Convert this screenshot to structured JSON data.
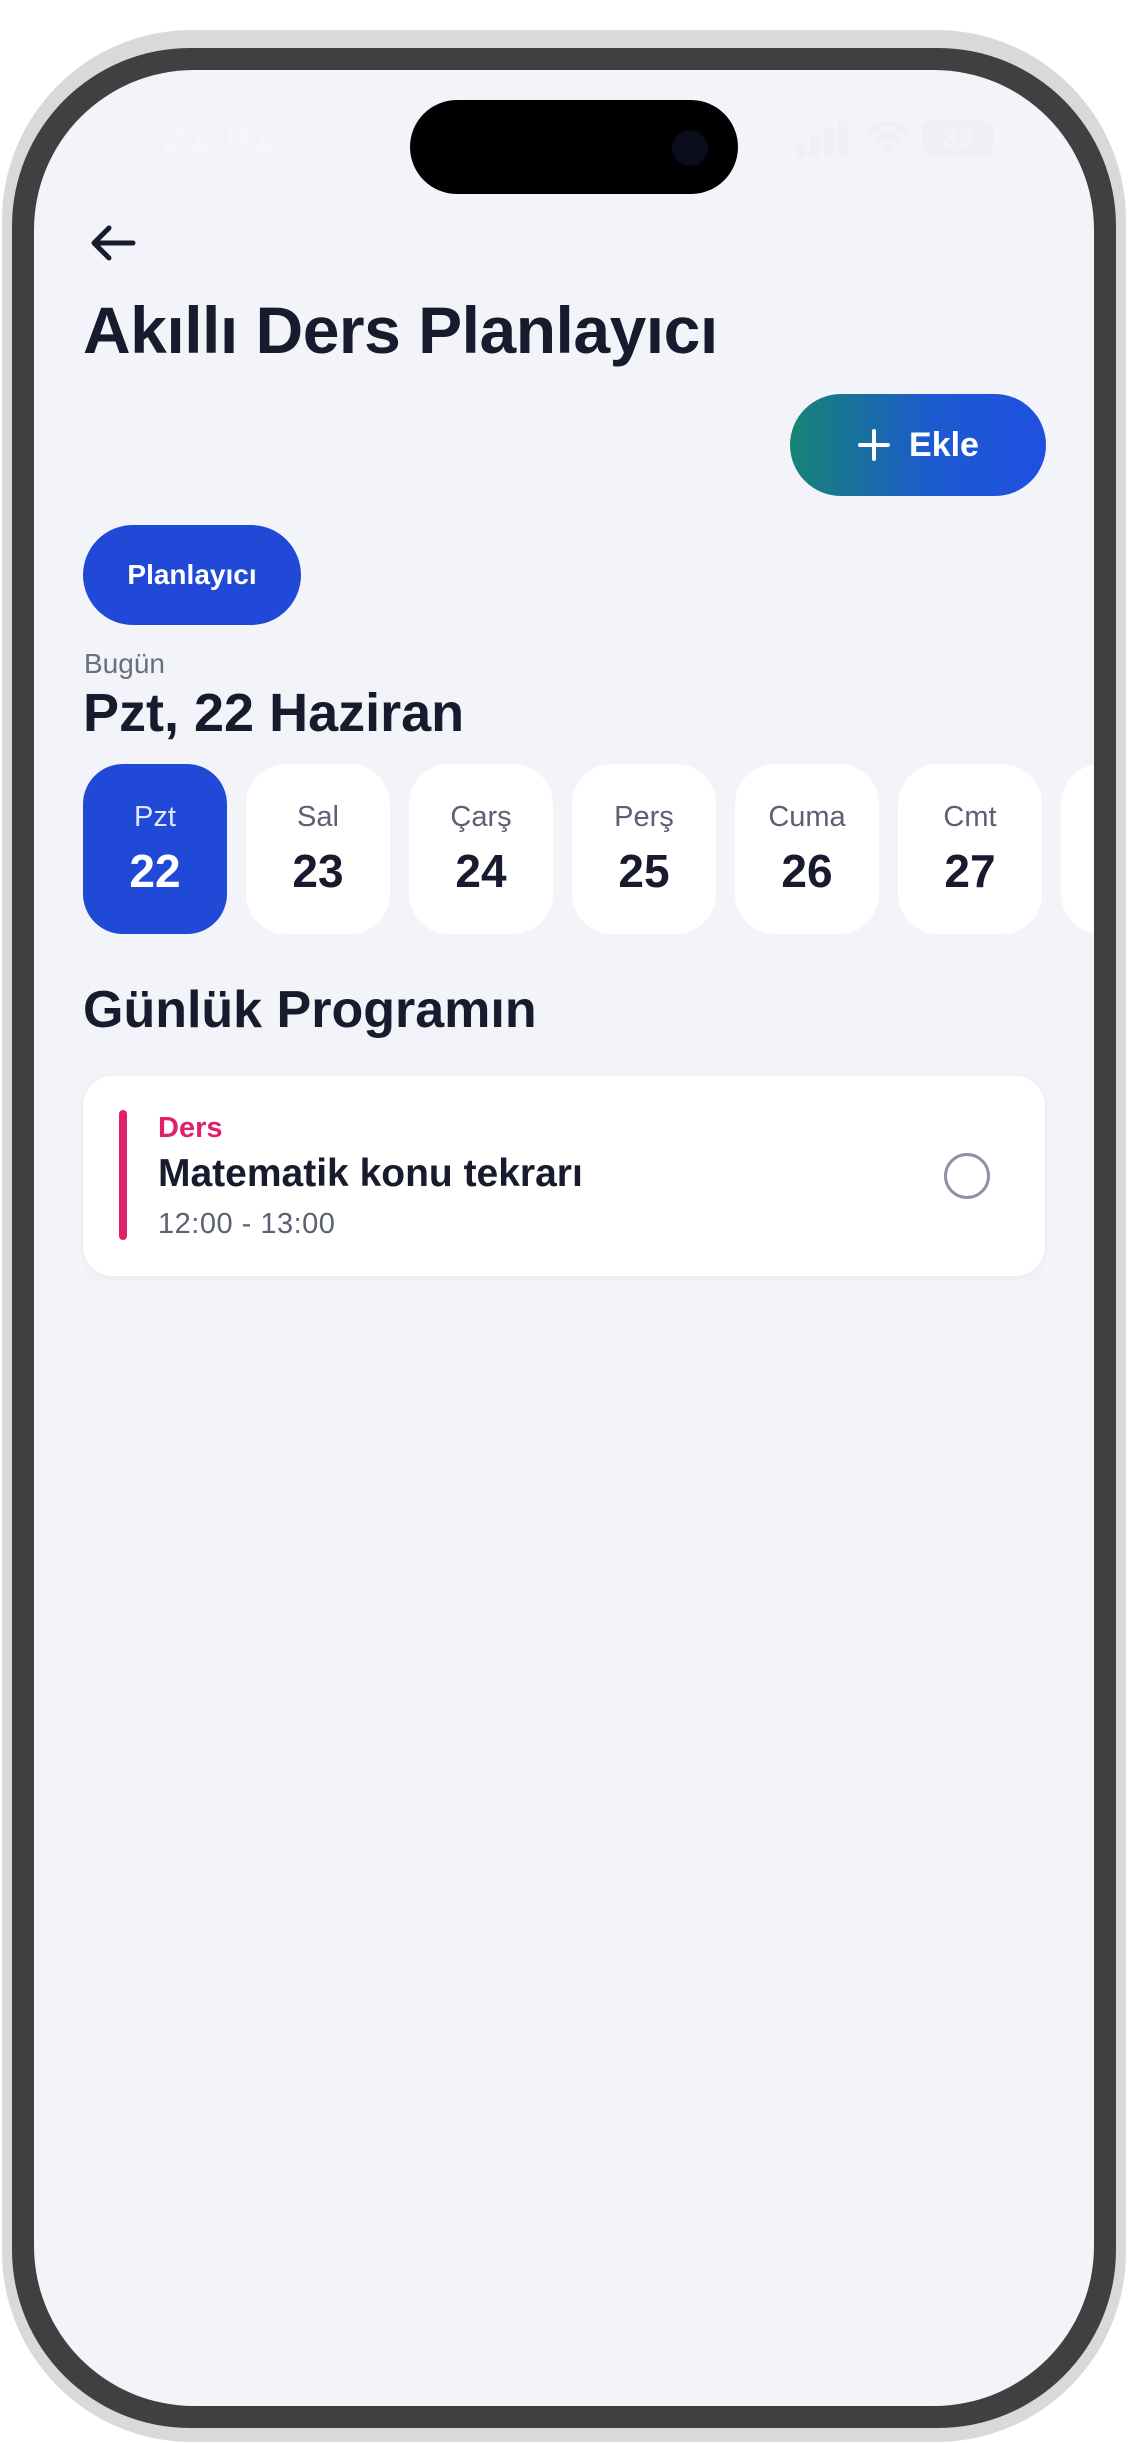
{
  "status_bar": {
    "time": "21:01",
    "battery": "38",
    "icons": [
      "signal-icon",
      "wifi-icon",
      "battery-icon"
    ]
  },
  "header": {
    "back_icon": "arrow-left-icon",
    "title": "Akıllı Ders Planlayıcı",
    "add_label": "Ekle",
    "add_icon": "plus-icon"
  },
  "tabs": [
    {
      "label": "Planlayıcı",
      "active": true
    }
  ],
  "today": {
    "label": "Bugün",
    "date": "Pzt, 22 Haziran"
  },
  "days": [
    {
      "name": "Pzt",
      "num": "22",
      "active": true
    },
    {
      "name": "Sal",
      "num": "23",
      "active": false
    },
    {
      "name": "Çarş",
      "num": "24",
      "active": false
    },
    {
      "name": "Perş",
      "num": "25",
      "active": false
    },
    {
      "name": "Cuma",
      "num": "26",
      "active": false
    },
    {
      "name": "Cmt",
      "num": "27",
      "active": false
    },
    {
      "name": "",
      "num": "",
      "active": false
    }
  ],
  "program": {
    "title": "Günlük Programın",
    "tasks": [
      {
        "type": "Ders",
        "title": "Matematik konu tekrarı",
        "time": "12:00 - 13:00",
        "accent_color": "#e0206b",
        "done": false
      }
    ]
  },
  "colors": {
    "primary": "#1f49d6",
    "gradient_start": "#178473",
    "background": "#f3f4f9",
    "text": "#181a2e"
  }
}
